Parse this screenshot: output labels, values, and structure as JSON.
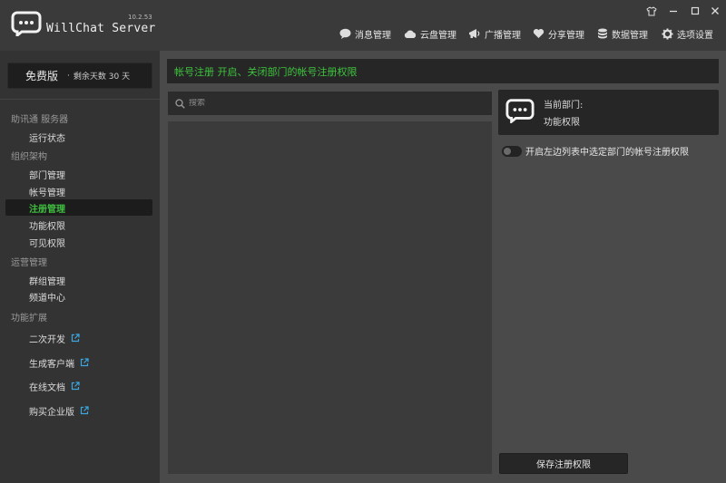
{
  "app": {
    "name": "WillChat Server",
    "version": "10.2.53"
  },
  "topnav": [
    {
      "label": "消息管理",
      "icon": "chat-bubble-icon"
    },
    {
      "label": "云盘管理",
      "icon": "cloud-icon"
    },
    {
      "label": "广播管理",
      "icon": "megaphone-icon"
    },
    {
      "label": "分享管理",
      "icon": "heart-icon"
    },
    {
      "label": "数据管理",
      "icon": "database-icon"
    },
    {
      "label": "选项设置",
      "icon": "gear-icon"
    }
  ],
  "badge": {
    "plan": "免费版",
    "separator": "·",
    "remaining": "剩余天数 30 天"
  },
  "sidebar": {
    "sections": [
      {
        "title": "助讯通 服务器",
        "items": [
          {
            "label": "运行状态"
          }
        ]
      },
      {
        "title": "组织架构",
        "items": [
          {
            "label": "部门管理"
          },
          {
            "label": "帐号管理"
          },
          {
            "label": "注册管理",
            "active": true
          },
          {
            "label": "功能权限"
          },
          {
            "label": "可见权限"
          }
        ]
      },
      {
        "title": "运营管理",
        "items": [
          {
            "label": "群组管理"
          },
          {
            "label": "频道中心"
          }
        ]
      },
      {
        "title": "功能扩展",
        "items": [
          {
            "label": "二次开发",
            "external": true
          },
          {
            "label": "生成客户端",
            "external": true
          },
          {
            "label": "在线文档",
            "external": true
          },
          {
            "label": "购买企业版",
            "external": true
          }
        ]
      }
    ]
  },
  "main": {
    "header": "帐号注册 开启、关闭部门的帐号注册权限",
    "search_placeholder": "搜索",
    "current_dept_label": "当前部门:",
    "current_dept_value": "功能权限",
    "toggle": {
      "label": "开启左边列表中选定部门的帐号注册权限",
      "on": false
    },
    "save_label": "保存注册权限"
  },
  "colors": {
    "accent": "#3ec43e",
    "background": "#4a4a4a",
    "panel": "#262626"
  }
}
